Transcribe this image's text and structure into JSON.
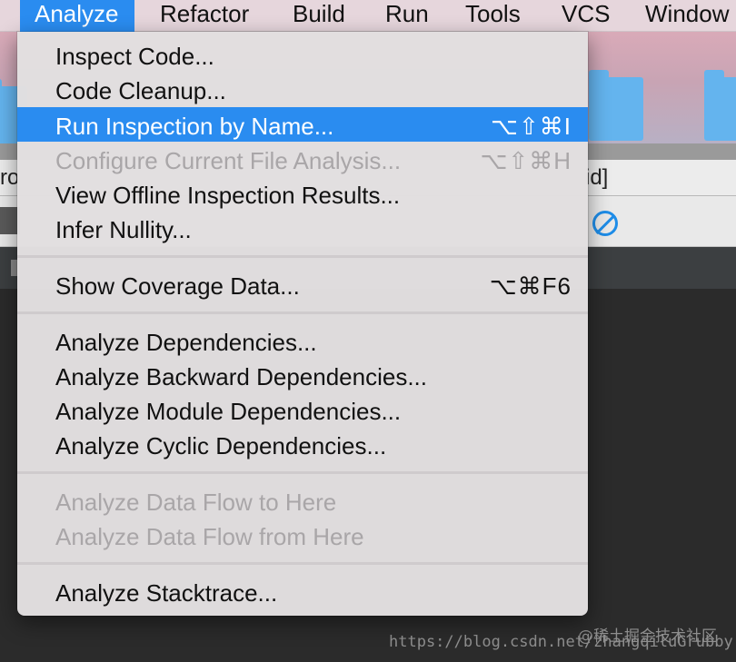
{
  "menubar": {
    "items": [
      "Analyze",
      "Refactor",
      "Build",
      "Run",
      "Tools",
      "VCS",
      "Window"
    ],
    "active_index": 0
  },
  "analyze_menu": {
    "groups": [
      {
        "items": [
          {
            "label": "Inspect Code...",
            "shortcut": "",
            "enabled": true,
            "highlighted": false
          },
          {
            "label": "Code Cleanup...",
            "shortcut": "",
            "enabled": true,
            "highlighted": false
          },
          {
            "label": "Run Inspection by Name...",
            "shortcut": "⌥⇧⌘I",
            "enabled": true,
            "highlighted": true
          },
          {
            "label": "Configure Current File Analysis...",
            "shortcut": "⌥⇧⌘H",
            "enabled": false,
            "highlighted": false
          },
          {
            "label": "View Offline Inspection Results...",
            "shortcut": "",
            "enabled": true,
            "highlighted": false
          },
          {
            "label": "Infer Nullity...",
            "shortcut": "",
            "enabled": true,
            "highlighted": false
          }
        ]
      },
      {
        "items": [
          {
            "label": "Show Coverage Data...",
            "shortcut": "⌥⌘F6",
            "enabled": true,
            "highlighted": false
          }
        ]
      },
      {
        "items": [
          {
            "label": "Analyze Dependencies...",
            "shortcut": "",
            "enabled": true,
            "highlighted": false
          },
          {
            "label": "Analyze Backward Dependencies...",
            "shortcut": "",
            "enabled": true,
            "highlighted": false
          },
          {
            "label": "Analyze Module Dependencies...",
            "shortcut": "",
            "enabled": true,
            "highlighted": false
          },
          {
            "label": "Analyze Cyclic Dependencies...",
            "shortcut": "",
            "enabled": true,
            "highlighted": false
          }
        ]
      },
      {
        "items": [
          {
            "label": "Analyze Data Flow to Here",
            "shortcut": "",
            "enabled": false,
            "highlighted": false
          },
          {
            "label": "Analyze Data Flow from Here",
            "shortcut": "",
            "enabled": false,
            "highlighted": false
          }
        ]
      },
      {
        "items": [
          {
            "label": "Analyze Stacktrace...",
            "shortcut": "",
            "enabled": true,
            "highlighted": false
          }
        ]
      }
    ]
  },
  "background": {
    "tab_fragment_left": "ro",
    "tab_fragment_right": "id]"
  },
  "watermark": {
    "url": "https://blog.csdn.net/zhangqiluGrubby",
    "site": "@稀土掘金技术社区"
  },
  "colors": {
    "highlight": "#2a8cf0",
    "menu_bg": "#e2dee0",
    "disabled_text": "#a9a6a8",
    "folder_blue": "#64b4ee",
    "icon_blue": "#1e8de8"
  }
}
